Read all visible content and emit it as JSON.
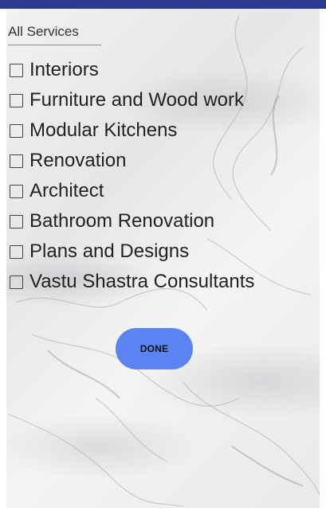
{
  "filter": {
    "category_label": "All Services"
  },
  "services": [
    {
      "label": "Interiors",
      "checked": false
    },
    {
      "label": "Furniture and Wood work",
      "checked": false
    },
    {
      "label": "Modular Kitchens",
      "checked": false
    },
    {
      "label": "Renovation",
      "checked": false
    },
    {
      "label": "Architect",
      "checked": false
    },
    {
      "label": "Bathroom Renovation",
      "checked": false
    },
    {
      "label": "Plans and Designs",
      "checked": false
    },
    {
      "label": "Vastu Shastra Consultants",
      "checked": false
    }
  ],
  "done_button": {
    "label": "DONE",
    "color": "#5b84f2"
  },
  "theme": {
    "status_bar_color": "#2b3a8c",
    "background": "marble"
  }
}
